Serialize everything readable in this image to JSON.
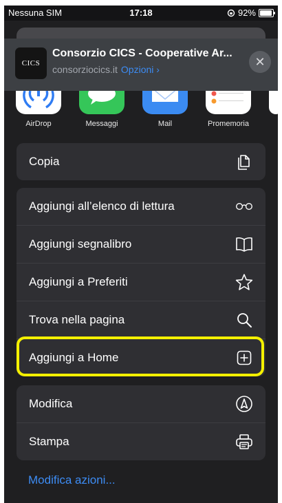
{
  "status_bar": {
    "carrier": "Nessuna SIM",
    "time": "17:18",
    "battery_percent": "92%",
    "battery_level": 0.92
  },
  "header": {
    "logo_text": "CICS",
    "title": "Consorzio CICS - Cooperative Ar...",
    "domain": "consorziocics.it",
    "options_label": "Opzioni",
    "options_chevron": "›",
    "close_glyph": "✕"
  },
  "apps": [
    {
      "label": "AirDrop",
      "icon": "airdrop-icon"
    },
    {
      "label": "Messaggi",
      "icon": "messages-icon"
    },
    {
      "label": "Mail",
      "icon": "mail-icon"
    },
    {
      "label": "Promemoria",
      "icon": "reminders-icon"
    }
  ],
  "actions": {
    "copy": {
      "label": "Copia",
      "icon": "copy-icon"
    },
    "reading_list": {
      "label": "Aggiungi all’elenco di lettura",
      "icon": "glasses-icon"
    },
    "bookmark": {
      "label": "Aggiungi segnalibro",
      "icon": "book-icon"
    },
    "favorites": {
      "label": "Aggiungi a Preferiti",
      "icon": "star-icon"
    },
    "find": {
      "label": "Trova nella pagina",
      "icon": "search-icon"
    },
    "add_home": {
      "label": "Aggiungi a Home",
      "icon": "plus-square-icon"
    },
    "markup": {
      "label": "Modifica",
      "icon": "markup-pen-icon"
    },
    "print": {
      "label": "Stampa",
      "icon": "printer-icon"
    }
  },
  "edit_actions_label": "Modifica azioni...",
  "colors": {
    "highlight": "#f4f000",
    "link": "#3d8cf4",
    "sheet_bg": "#1f1f21",
    "row_bg": "#2f2f33"
  }
}
